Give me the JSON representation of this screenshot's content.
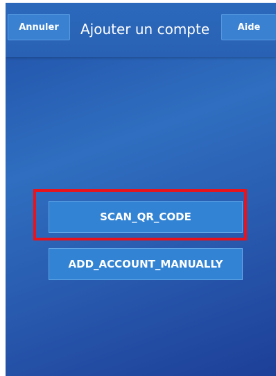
{
  "header": {
    "cancel_label": "Annuler",
    "title": "Ajouter un compte",
    "help_label": "Aide"
  },
  "main": {
    "scan_label": "SCAN_QR_CODE",
    "manual_label": "ADD_ACCOUNT_MANUALLY"
  },
  "colors": {
    "background": "#2a5fb3",
    "button": "#3283d3",
    "highlight": "#e8131b",
    "text": "#ffffff"
  }
}
